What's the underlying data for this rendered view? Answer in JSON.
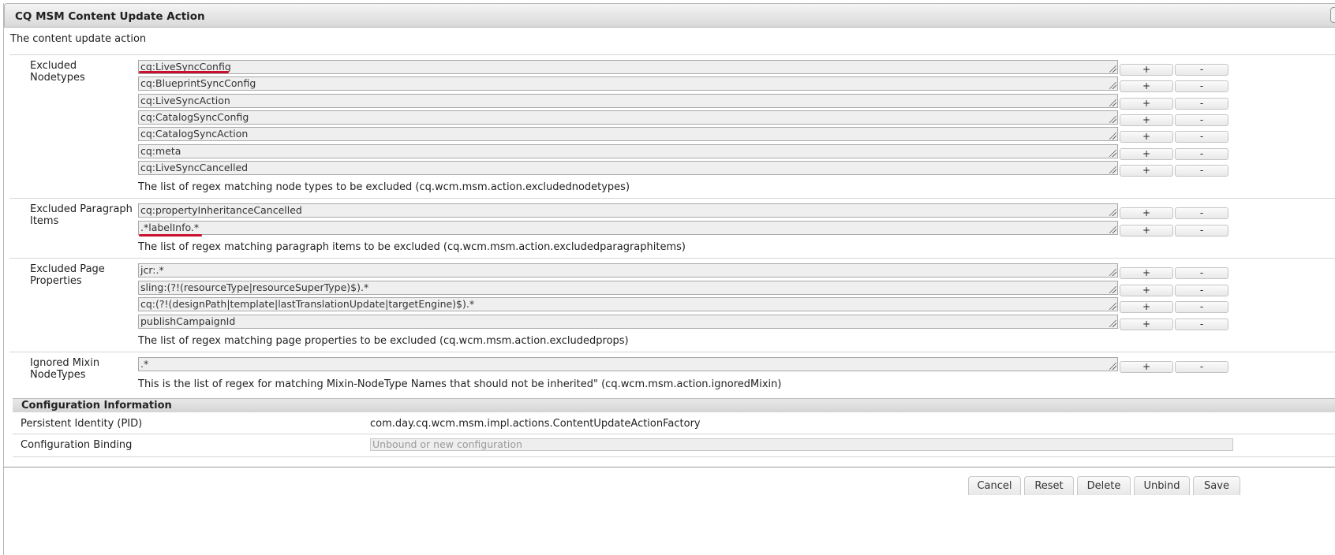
{
  "dialog": {
    "title": "CQ MSM Content Update Action",
    "close_glyph": "✕",
    "description": "The content update action"
  },
  "plus_label": "+",
  "minus_label": "-",
  "sections": [
    {
      "label": "Excluded Nodetypes",
      "values": [
        "cq:LiveSyncConfig",
        "cq:BlueprintSyncConfig",
        "cq:LiveSyncAction",
        "cq:CatalogSyncConfig",
        "cq:CatalogSyncAction",
        "cq:meta",
        "cq:LiveSyncCancelled"
      ],
      "help": "The list of regex matching node types to be excluded (cq.wcm.msm.action.excludednodetypes)"
    },
    {
      "label": "Excluded Paragraph Items",
      "values": [
        "cq:propertyInheritanceCancelled",
        ".*labelInfo.*"
      ],
      "help": "The list of regex matching paragraph items to be excluded (cq.wcm.msm.action.excludedparagraphitems)"
    },
    {
      "label": "Excluded Page Properties",
      "values": [
        "jcr:.*",
        "sling:(?!(resourceType|resourceSuperType)$).*",
        "cq:(?!(designPath|template|lastTranslationUpdate|targetEngine)$).*",
        "publishCampaignId"
      ],
      "help": "The list of regex matching page properties to be excluded (cq.wcm.msm.action.excludedprops)"
    },
    {
      "label": "Ignored Mixin NodeTypes",
      "values": [
        ".*"
      ],
      "help": "This is the list of regex for matching Mixin-NodeType Names that should not be inherited\" (cq.wcm.msm.action.ignoredMixin)"
    }
  ],
  "config_info": {
    "heading": "Configuration Information",
    "pid_label": "Persistent Identity (PID)",
    "pid_value": "com.day.cq.wcm.msm.impl.actions.ContentUpdateActionFactory",
    "binding_label": "Configuration Binding",
    "binding_placeholder": "Unbound or new configuration"
  },
  "actions": {
    "cancel": "Cancel",
    "reset": "Reset",
    "delete": "Delete",
    "unbind": "Unbind",
    "save": "Save"
  },
  "colors": {
    "annotation_underline": "#c8102e"
  }
}
